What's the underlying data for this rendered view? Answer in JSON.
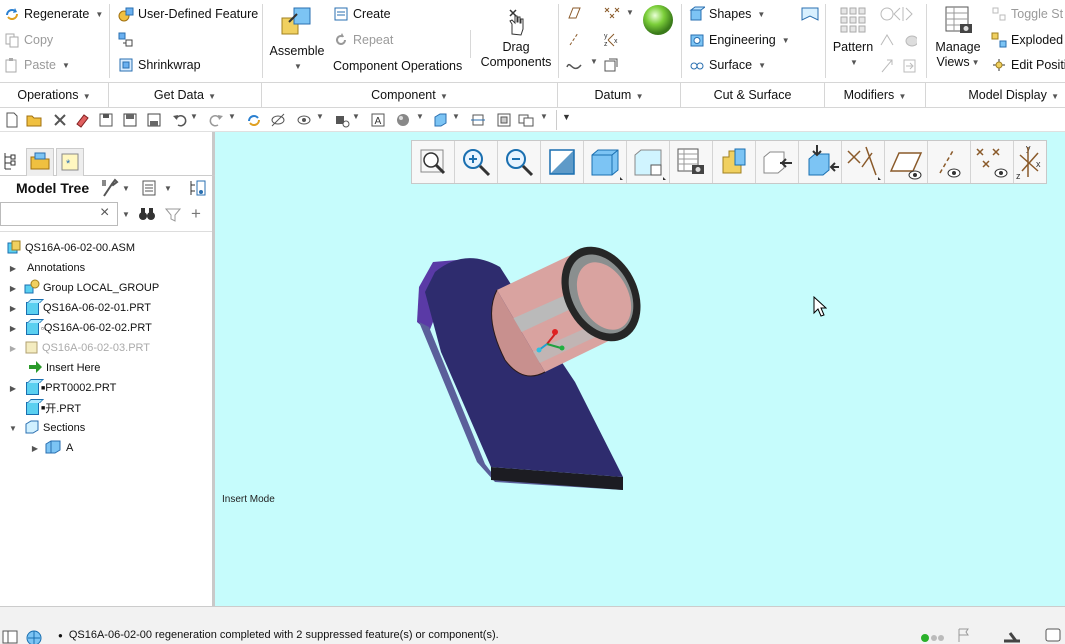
{
  "ribbon": {
    "operations": {
      "regenerate": "Regenerate",
      "copy": "Copy",
      "paste": "Paste"
    },
    "get_data": {
      "user_defined_feature": "User-Defined Feature",
      "shrinkwrap": "Shrinkwrap"
    },
    "component": {
      "assemble": "Assemble",
      "create": "Create",
      "repeat": "Repeat",
      "component_operations": "Component Operations",
      "drag_components_line1": "Drag",
      "drag_components_line2": "Components"
    },
    "cut_surface": {
      "shapes": "Shapes",
      "engineering": "Engineering",
      "surface": "Surface"
    },
    "modifiers": {
      "pattern": "Pattern"
    },
    "model_display": {
      "manage_views_line1": "Manage",
      "manage_views_line2": "Views",
      "toggle": "Toggle St",
      "exploded": "Exploded",
      "edit_position": "Edit Positi"
    }
  },
  "groups": {
    "operations": "Operations",
    "get_data": "Get Data",
    "component": "Component",
    "datum": "Datum",
    "cut_surface": "Cut & Surface",
    "modifiers": "Modifiers",
    "model_display": "Model Display"
  },
  "model_tree": {
    "title": "Model Tree",
    "items": [
      {
        "label": "QS16A-06-02-00.ASM",
        "type": "asm"
      },
      {
        "label": "Annotations",
        "type": "annot"
      },
      {
        "label": "Group LOCAL_GROUP",
        "type": "group"
      },
      {
        "label": "QS16A-06-02-01.PRT",
        "type": "part"
      },
      {
        "label": "QS16A-06-02-02.PRT",
        "type": "part"
      },
      {
        "label": "QS16A-06-02-03.PRT",
        "type": "suppressed"
      },
      {
        "label": "Insert Here",
        "type": "insert"
      },
      {
        "label": "PRT0002.PRT",
        "type": "part"
      },
      {
        "label": "开.PRT",
        "type": "part"
      },
      {
        "label": "Sections",
        "type": "sections"
      },
      {
        "label": "A",
        "type": "section"
      }
    ]
  },
  "viewport": {
    "mode_text": "Insert Mode",
    "background": "#c6fcfc"
  },
  "status": {
    "message": "QS16A-06-02-00 regeneration completed with 2 suppressed feature(s) or component(s)."
  },
  "colors": {
    "accent": "#1a6fb0",
    "base_plate": "#2e2c6e",
    "cylinder": "#d9a3a0"
  }
}
